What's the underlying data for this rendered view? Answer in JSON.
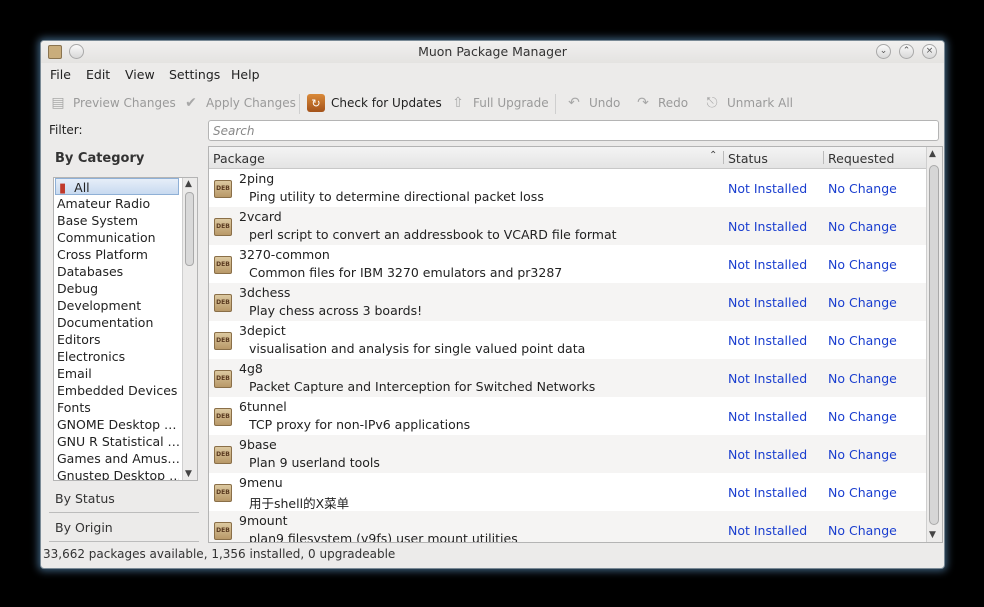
{
  "window": {
    "title": "Muon Package Manager"
  },
  "menu": [
    "File",
    "Edit",
    "View",
    "Settings",
    "Help"
  ],
  "toolbar": {
    "preview": "Preview Changes",
    "apply": "Apply Changes",
    "check": "Check for Updates",
    "upgrade": "Full Upgrade",
    "undo": "Undo",
    "redo": "Redo",
    "unmark": "Unmark All"
  },
  "filter": {
    "label": "Filter:",
    "by_category": "By Category",
    "categories": [
      "All",
      "Amateur Radio",
      "Base System",
      "Communication",
      "Cross Platform",
      "Databases",
      "Debug",
      "Development",
      "Documentation",
      "Editors",
      "Electronics",
      "Email",
      "Embedded Devices",
      "Fonts",
      "GNOME Desktop …",
      "GNU R Statistical …",
      "Games and Amus…",
      "Gnustep Desktop …"
    ],
    "by_status": "By Status",
    "by_origin": "By Origin"
  },
  "search": {
    "placeholder": "Search"
  },
  "table": {
    "headers": {
      "package": "Package",
      "status": "Status",
      "requested": "Requested"
    },
    "rows": [
      {
        "name": "2ping",
        "desc": "Ping utility to determine directional packet loss",
        "status": "Not Installed",
        "requested": "No Change"
      },
      {
        "name": "2vcard",
        "desc": "perl script to convert an addressbook to VCARD file format",
        "status": "Not Installed",
        "requested": "No Change"
      },
      {
        "name": "3270-common",
        "desc": "Common files for IBM 3270 emulators and pr3287",
        "status": "Not Installed",
        "requested": "No Change"
      },
      {
        "name": "3dchess",
        "desc": "Play chess across 3 boards!",
        "status": "Not Installed",
        "requested": "No Change"
      },
      {
        "name": "3depict",
        "desc": "visualisation and analysis for single valued point data",
        "status": "Not Installed",
        "requested": "No Change"
      },
      {
        "name": "4g8",
        "desc": "Packet Capture and Interception for Switched Networks",
        "status": "Not Installed",
        "requested": "No Change"
      },
      {
        "name": "6tunnel",
        "desc": "TCP proxy for non-IPv6 applications",
        "status": "Not Installed",
        "requested": "No Change"
      },
      {
        "name": "9base",
        "desc": "Plan 9 userland tools",
        "status": "Not Installed",
        "requested": "No Change"
      },
      {
        "name": "9menu",
        "desc": "用于shell的X菜单",
        "status": "Not Installed",
        "requested": "No Change"
      },
      {
        "name": "9mount",
        "desc": "plan9 filesystem (v9fs) user mount utilities",
        "status": "Not Installed",
        "requested": "No Change"
      }
    ]
  },
  "statusbar": "33,662 packages available, 1,356 installed, 0 upgradeable"
}
